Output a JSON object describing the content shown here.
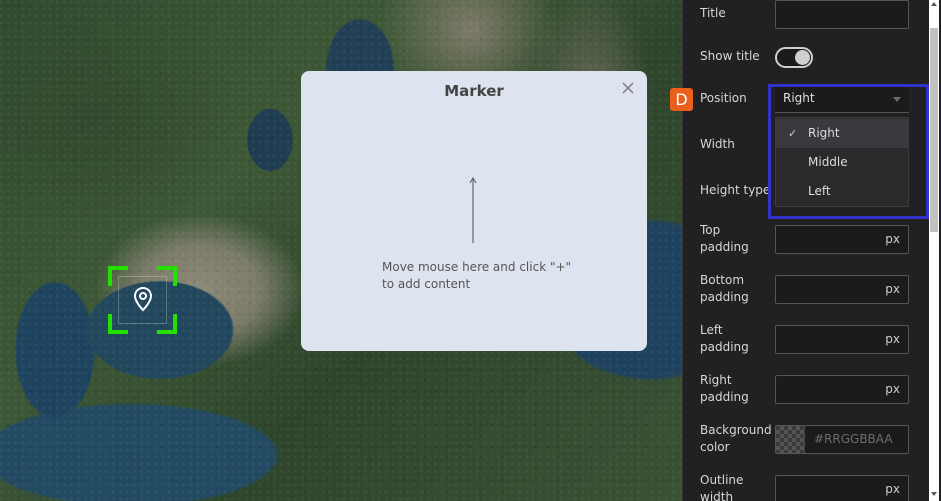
{
  "modal": {
    "title": "Marker",
    "hint": "Move mouse here and click \"+\" to add content",
    "close_icon": "close-icon",
    "arrow_icon": "arrow-up-icon"
  },
  "map": {
    "marker_icon": "map-pin-icon"
  },
  "panel": {
    "title_label": "Title",
    "title_value": "",
    "show_title_label": "Show title",
    "show_title_on": true,
    "position_label": "Position",
    "position_value": "Right",
    "position_options": [
      "Right",
      "Middle",
      "Left"
    ],
    "width_label": "Width",
    "height_type_label": "Height type",
    "top_padding_label": "Top padding",
    "bottom_padding_label": "Bottom padding",
    "left_padding_label": "Left padding",
    "right_padding_label": "Right padding",
    "background_color_label": "Background color",
    "background_color_placeholder": "#RRGGBBAA",
    "outline_width_label": "Outline width",
    "unit": "px"
  },
  "annotation": {
    "badge_text": "D",
    "badge_color": "#e8601c",
    "highlight_color": "#3333cc"
  },
  "colors": {
    "selection_green": "#22e000",
    "panel_bg": "#212123",
    "modal_bg": "#dde3ef"
  }
}
